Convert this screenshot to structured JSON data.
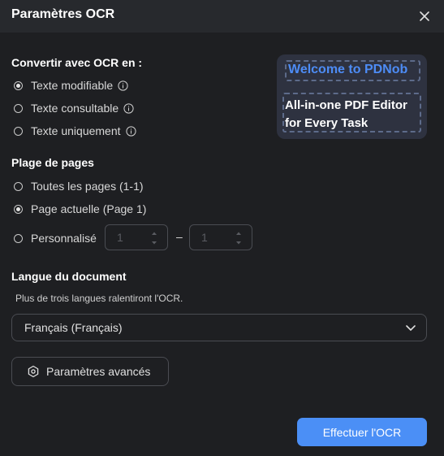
{
  "dialog": {
    "title": "Paramètres OCR",
    "close_icon": "close-icon"
  },
  "convert": {
    "heading": "Convertir avec OCR en :",
    "options": [
      {
        "label": "Texte modifiable",
        "selected": true,
        "icon": "info-icon"
      },
      {
        "label": "Texte consultable",
        "selected": false,
        "icon": "info-icon"
      },
      {
        "label": "Texte uniquement",
        "selected": false,
        "icon": "info-icon"
      }
    ]
  },
  "preview": {
    "line1": "Welcome to PDNob",
    "line2": "All-in-one PDF Editor for Every Task",
    "accent": "#4d8cf5"
  },
  "page_range": {
    "heading": "Plage de pages",
    "options": [
      {
        "label": "Toutes les pages (1-1)",
        "selected": false
      },
      {
        "label": "Page actuelle (Page 1)",
        "selected": true
      },
      {
        "label": "Personnalisé",
        "selected": false
      }
    ],
    "from_value": "1",
    "to_value": "1",
    "separator": "–"
  },
  "language": {
    "heading": "Langue du document",
    "hint": "Plus de trois langues ralentiront l'OCR.",
    "selected": "Français (Français)",
    "chevron_icon": "chevron-down-icon"
  },
  "advanced_button": {
    "label": "Paramètres avancés",
    "icon": "settings-hexagon-icon"
  },
  "primary_button": {
    "label": "Effectuer l'OCR",
    "color": "#4b8ff6"
  }
}
